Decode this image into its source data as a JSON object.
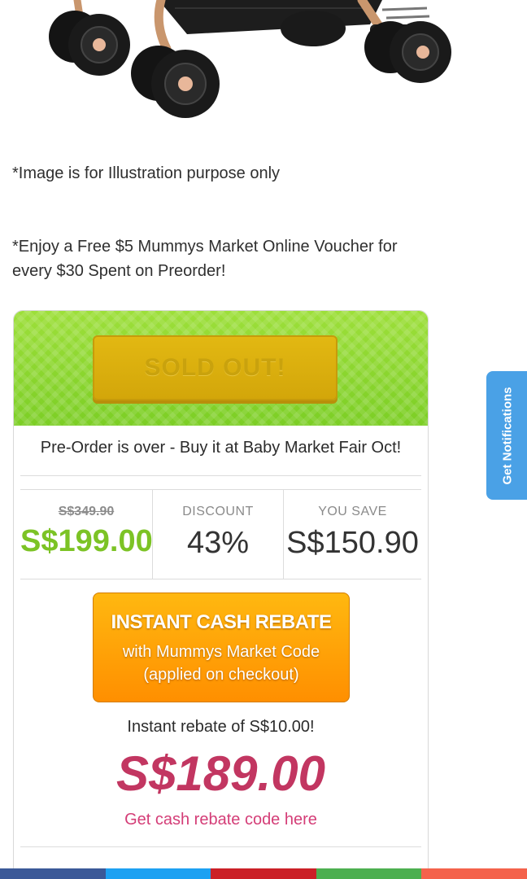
{
  "notes": [
    "*Image is for Illustration purpose only",
    "*Enjoy a Free $5 Mummys Market Online Voucher for every $30 Spent on Preorder!"
  ],
  "deal": {
    "sold_out_label": "SOLD OUT!",
    "preorder_message": "Pre-Order is over - Buy it at Baby Market Fair Oct!",
    "original_price": "S$349.90",
    "sale_price": "S$199.00",
    "discount_label": "DISCOUNT",
    "discount_value": "43%",
    "save_label": "YOU SAVE",
    "save_value": "S$150.90",
    "rebate_title": "INSTANT CASH REBATE",
    "rebate_sub_1": "with Mummys Market Code",
    "rebate_sub_2": "(applied on checkout)",
    "rebate_line": "Instant rebate of S$10.00!",
    "final_price": "S$189.00",
    "code_link": "Get cash rebate code here"
  },
  "side_tab": {
    "label": "Get Notifications"
  },
  "share_bar_colors": [
    "#3b5998",
    "#1da1f2",
    "#cb2027",
    "#4caf50",
    "#f4624b"
  ],
  "colors": {
    "banner_green": "#8ed62f",
    "sold_out_yellow": "#d9ae0e",
    "sale_green": "#7cc325",
    "rebate_orange": "#ffa000",
    "final_price_pink": "#c23661",
    "link_pink": "#d43d77",
    "tab_blue": "#4aa1e6"
  }
}
